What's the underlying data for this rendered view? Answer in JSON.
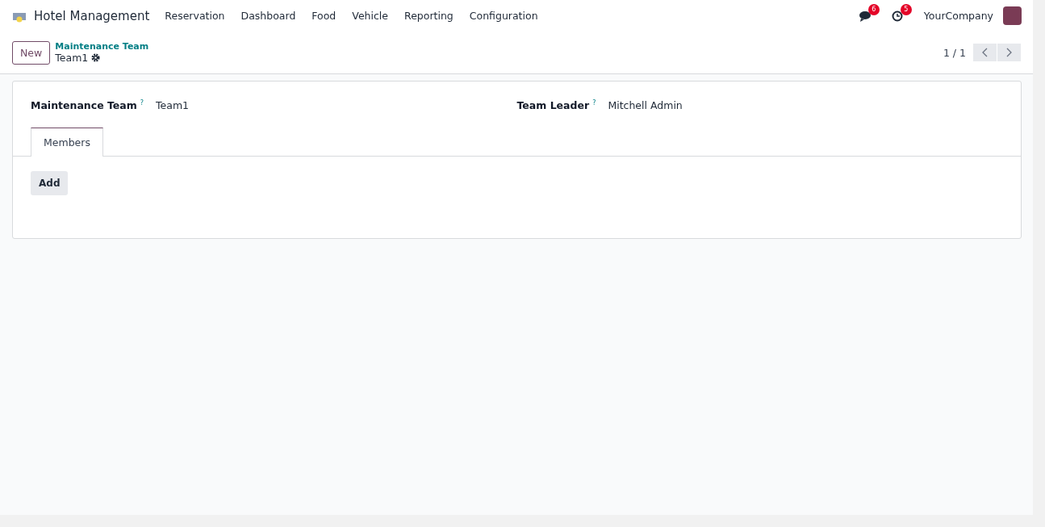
{
  "app": {
    "name": "Hotel Management"
  },
  "menu": [
    {
      "label": "Reservation"
    },
    {
      "label": "Dashboard"
    },
    {
      "label": "Food"
    },
    {
      "label": "Vehicle"
    },
    {
      "label": "Reporting"
    },
    {
      "label": "Configuration"
    }
  ],
  "systray": {
    "messages_badge": "6",
    "activities_badge": "5",
    "company": "YourCompany"
  },
  "control_panel": {
    "new_button": "New",
    "breadcrumb": "Maintenance Team",
    "record": "Team1",
    "pager": "1 / 1"
  },
  "form": {
    "fields": [
      {
        "label": "Maintenance Team",
        "help": "?",
        "value": "Team1"
      },
      {
        "label": "Team Leader",
        "help": "?",
        "value": "Mitchell Admin"
      }
    ],
    "tabs": [
      {
        "label": "Members",
        "selected": true
      }
    ],
    "add_button": "Add"
  }
}
